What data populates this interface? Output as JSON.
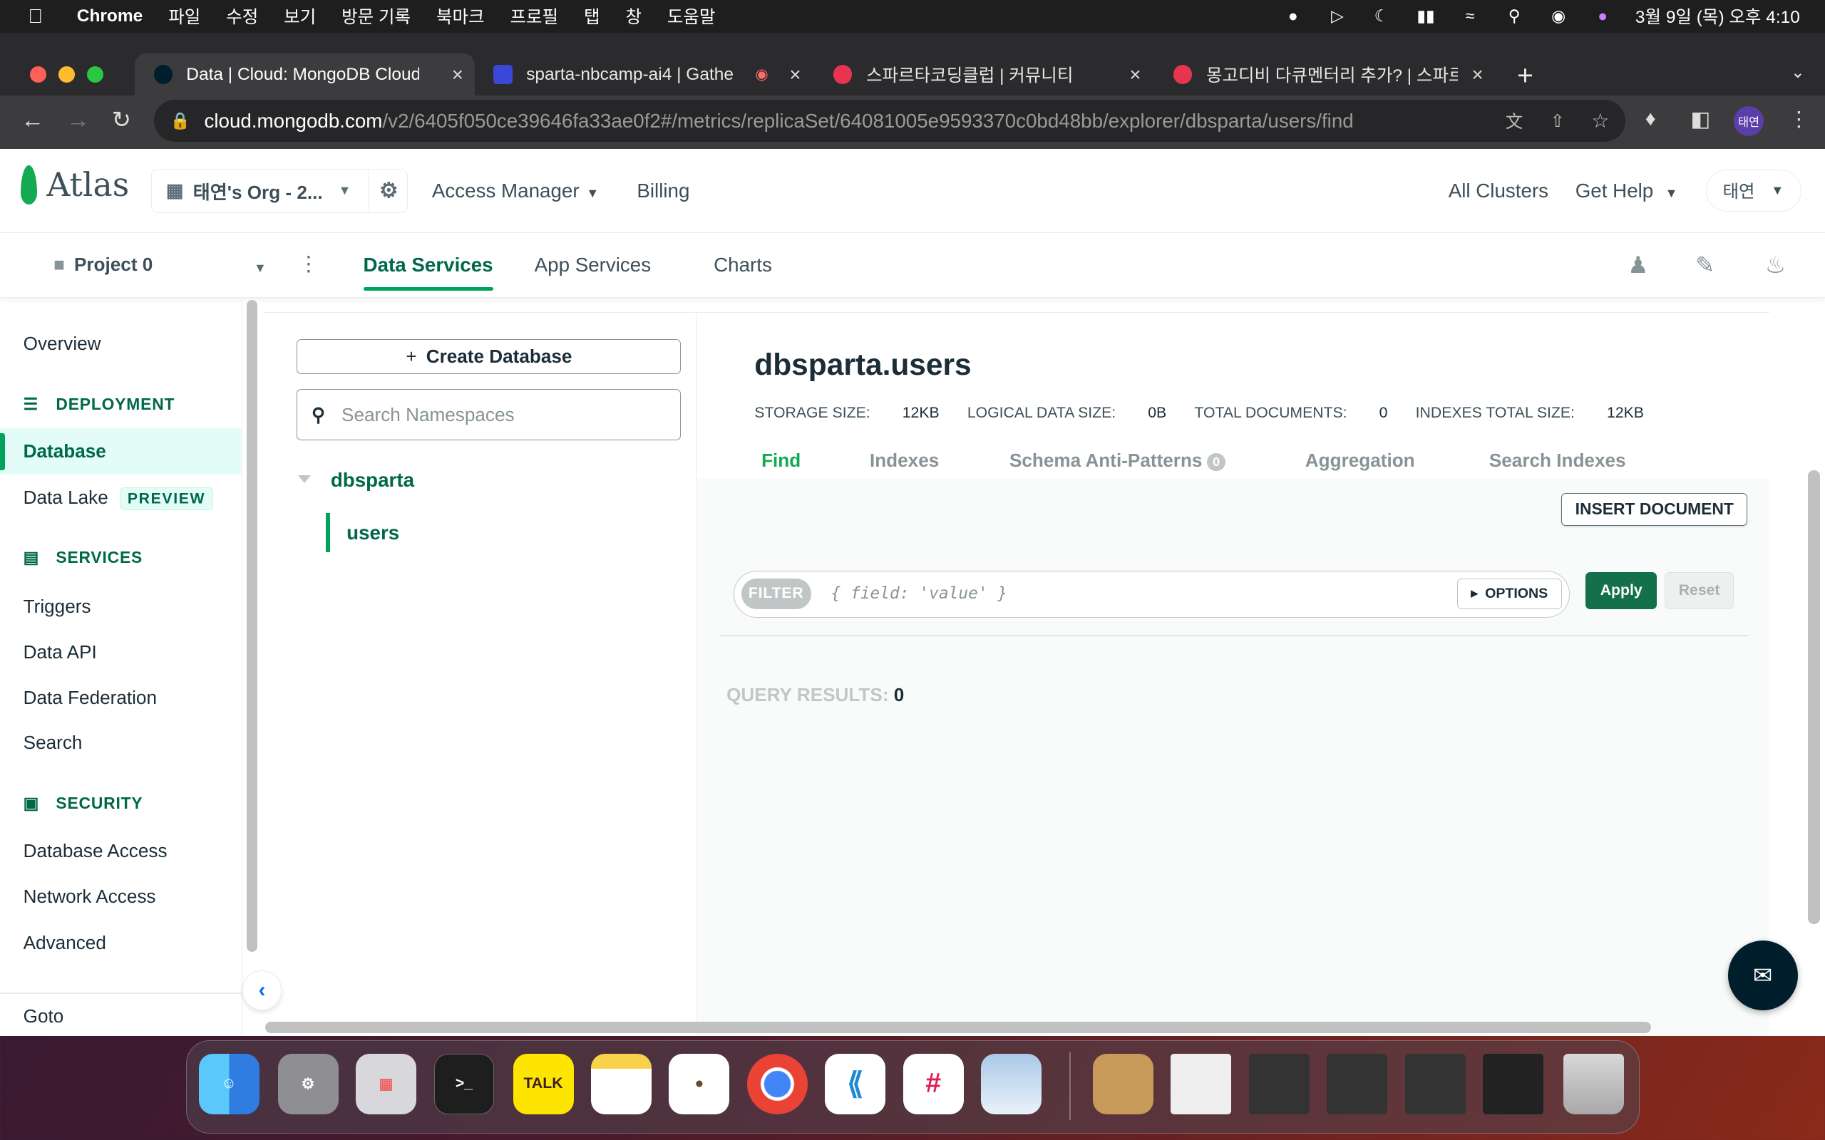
{
  "menubar": {
    "app": "Chrome",
    "items": [
      "파일",
      "수정",
      "보기",
      "방문 기록",
      "북마크",
      "프로필",
      "탭",
      "창",
      "도움말"
    ],
    "clock": "3월 9일 (목) 오후 4:10"
  },
  "browser": {
    "tabs": [
      {
        "label": "Data | Cloud: MongoDB Cloud",
        "active": true
      },
      {
        "label": "sparta-nbcamp-ai4 | Gathe",
        "active": false
      },
      {
        "label": "스파르타코딩클럽 | 커뮤니티",
        "active": false
      },
      {
        "label": "몽고디비 다큐멘터리 추가? | 스파르타",
        "active": false
      }
    ],
    "url_host": "cloud.mongodb.com",
    "url_path": "/v2/6405f050ce39646fa33ae0f2#/metrics/replicaSet/64081005e9593370c0bd48bb/explorer/dbsparta/users/find",
    "profile": "태연"
  },
  "topnav": {
    "logo": "Atlas",
    "org": "태연's Org - 2...",
    "access_manager": "Access Manager",
    "billing": "Billing",
    "all_clusters": "All Clusters",
    "get_help": "Get Help",
    "user": "태연"
  },
  "subnav": {
    "project": "Project 0",
    "tabs": [
      "Data Services",
      "App Services",
      "Charts"
    ]
  },
  "sidebar": {
    "overview": "Overview",
    "deployment": "DEPLOYMENT",
    "database": "Database",
    "data_lake": "Data Lake",
    "preview": "PREVIEW",
    "services": "SERVICES",
    "triggers": "Triggers",
    "data_api": "Data API",
    "data_federation": "Data Federation",
    "search": "Search",
    "security": "SECURITY",
    "database_access": "Database Access",
    "network_access": "Network Access",
    "advanced": "Advanced",
    "goto": "Goto"
  },
  "tree": {
    "create_db": "Create Database",
    "search_placeholder": "Search Namespaces",
    "database": "dbsparta",
    "collection": "users"
  },
  "main": {
    "title": "dbsparta.users",
    "stats": [
      {
        "label": "STORAGE SIZE:",
        "value": "12KB"
      },
      {
        "label": "LOGICAL DATA SIZE:",
        "value": "0B"
      },
      {
        "label": "TOTAL DOCUMENTS:",
        "value": "0"
      },
      {
        "label": "INDEXES TOTAL SIZE:",
        "value": "12KB"
      }
    ],
    "tabs": [
      "Find",
      "Indexes",
      "Schema Anti-Patterns",
      "Aggregation",
      "Search Indexes"
    ],
    "anti_pattern_count": "0",
    "insert_document": "INSERT DOCUMENT",
    "filter_label": "FILTER",
    "filter_placeholder": "{ field: 'value' }",
    "options": "OPTIONS",
    "apply": "Apply",
    "reset": "Reset",
    "query_results_label": "QUERY RESULTS:",
    "query_results_count": "0"
  },
  "dock": {
    "talk": "TALK"
  },
  "colors": {
    "accent_green": "#00684a",
    "bright_green": "#13aa52",
    "apply_button": "#13704a"
  }
}
